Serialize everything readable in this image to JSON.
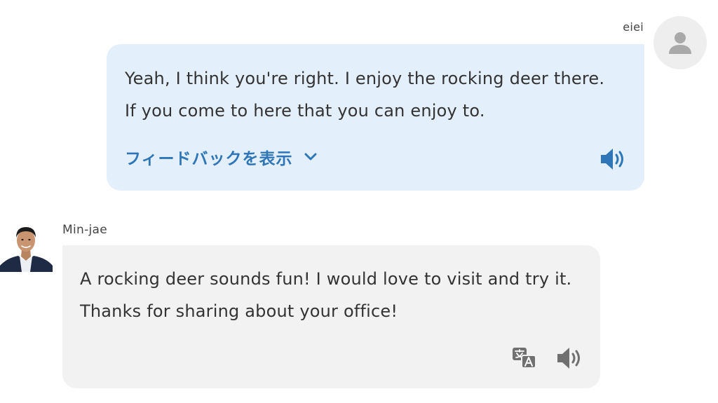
{
  "user_message": {
    "sender": "eiei",
    "text": "Yeah, I think you're right. I enjoy the rocking deer there. If you come to here that you can enjoy to.",
    "feedback_label": "フィードバックを表示",
    "icons": {
      "avatar": "person-icon",
      "expand": "chevron-down-icon",
      "audio": "speaker-icon"
    },
    "colors": {
      "bubble": "#e3f0fc",
      "accent": "#2f76b8"
    }
  },
  "bot_message": {
    "sender": "Min-jae",
    "text": "A rocking deer sounds fun! I would love to visit and try it. Thanks for sharing about your office!",
    "icons": {
      "avatar": "profile-photo",
      "translate": "translate-icon",
      "audio": "speaker-icon"
    },
    "colors": {
      "bubble": "#f2f2f2"
    }
  }
}
